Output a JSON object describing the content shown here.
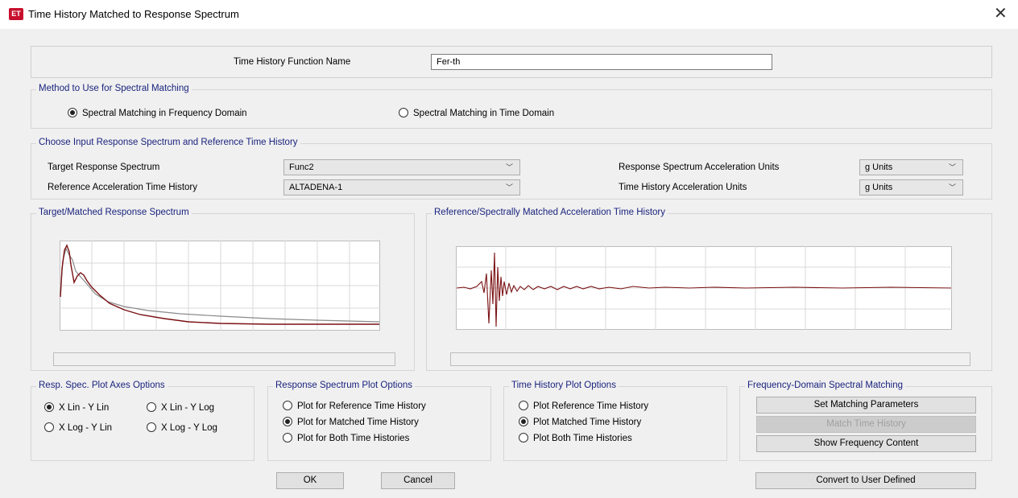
{
  "window": {
    "title": "Time History Matched to Response Spectrum",
    "app_icon_text": "ET"
  },
  "function_name": {
    "label": "Time History Function Name",
    "value": "Fer-th"
  },
  "method": {
    "title": "Method to Use for Spectral Matching",
    "options": [
      "Spectral Matching in Frequency Domain",
      "Spectral Matching in Time Domain"
    ],
    "selected": 0
  },
  "inputs": {
    "title": "Choose Input Response Spectrum and Reference Time History",
    "target_spectrum_label": "Target Response Spectrum",
    "target_spectrum_value": "Func2",
    "reference_history_label": "Reference Acceleration Time History",
    "reference_history_value": "ALTADENA-1",
    "rs_units_label": "Response Spectrum Acceleration Units",
    "rs_units_value": "g Units",
    "th_units_label": "Time History Acceleration Units",
    "th_units_value": "g Units"
  },
  "plots": {
    "spectrum_title": "Target/Matched Response Spectrum",
    "history_title": "Reference/Spectrally Matched Acceleration Time History"
  },
  "axes_options": {
    "title": "Resp. Spec. Plot Axes Options",
    "options": [
      "X Lin - Y Lin",
      "X Lin - Y Log",
      "X Log - Y Lin",
      "X Log - Y Log"
    ],
    "selected": 0
  },
  "rs_plot_options": {
    "title": "Response Spectrum Plot Options",
    "options": [
      "Plot for Reference Time History",
      "Plot for Matched Time History",
      "Plot for Both Time Histories"
    ],
    "selected": 1
  },
  "th_plot_options": {
    "title": "Time History Plot Options",
    "options": [
      "Plot Reference Time History",
      "Plot Matched Time History",
      "Plot Both Time Histories"
    ],
    "selected": 1
  },
  "freq_matching": {
    "title": "Frequency-Domain Spectral Matching",
    "set_params": "Set Matching Parameters",
    "match_history": "Match Time History",
    "show_freq": "Show Frequency Content"
  },
  "buttons": {
    "ok": "OK",
    "cancel": "Cancel",
    "convert": "Convert to User Defined"
  },
  "colors": {
    "accent_title": "#1a237e",
    "curve_matched": "#7b1113",
    "curve_target": "#8a8a8a"
  }
}
